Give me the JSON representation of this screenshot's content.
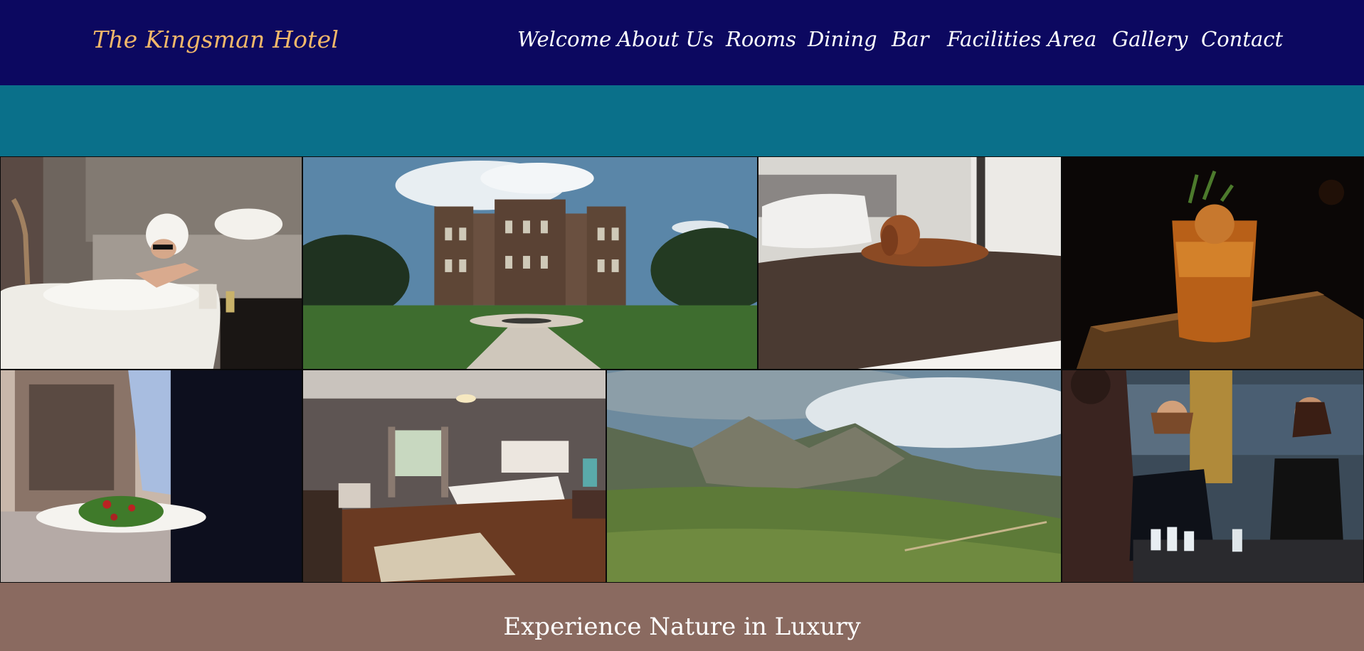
{
  "header": {
    "brand": "The Kingsman Hotel",
    "nav": [
      {
        "label": "Welcome"
      },
      {
        "label": "About Us"
      },
      {
        "label": "Rooms"
      },
      {
        "label": "Dining"
      },
      {
        "label": "Bar"
      },
      {
        "label": "Facilities"
      },
      {
        "label": "Area"
      },
      {
        "label": "Gallery"
      },
      {
        "label": "Contact"
      }
    ]
  },
  "gallery": {
    "images": [
      {
        "subject": "woman relaxing in a bubble bath"
      },
      {
        "subject": "stately manor house with lawn and driveway"
      },
      {
        "subject": "golden retriever lying on a bed"
      },
      {
        "subject": "cocktail on a dark bar counter"
      },
      {
        "subject": "waiter holding a plated salad"
      },
      {
        "subject": "hotel bedroom with rug and window"
      },
      {
        "subject": "highland mountains under cloudy sky"
      },
      {
        "subject": "bartenders preparing drinks"
      }
    ]
  },
  "footer": {
    "tagline": "Experience Nature in Luxury"
  },
  "colors": {
    "header_bg": "#0c0860",
    "brand": "#f2b86a",
    "band": "#0a708a",
    "footer_bg": "#8a6a60"
  }
}
